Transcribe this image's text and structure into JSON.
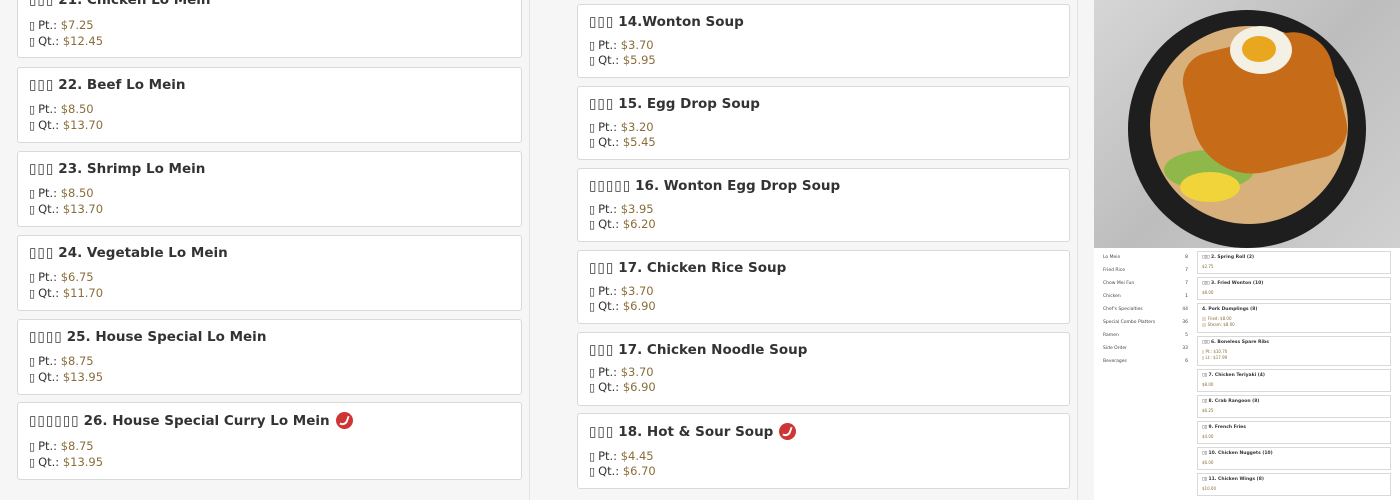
{
  "left_column": {
    "items": [
      {
        "cjk": "▯▯▯",
        "title": "21. Chicken Lo Mein",
        "pt_label": "Pt.:",
        "pt": "$7.25",
        "qt_label": "Qt.:",
        "qt": "$12.45"
      },
      {
        "cjk": "▯▯▯",
        "title": "22. Beef Lo Mein",
        "pt_label": "Pt.:",
        "pt": "$8.50",
        "qt_label": "Qt.:",
        "qt": "$13.70"
      },
      {
        "cjk": "▯▯▯",
        "title": "23. Shrimp Lo Mein",
        "pt_label": "Pt.:",
        "pt": "$8.50",
        "qt_label": "Qt.:",
        "qt": "$13.70"
      },
      {
        "cjk": "▯▯▯",
        "title": "24. Vegetable Lo Mein",
        "pt_label": "Pt.:",
        "pt": "$6.75",
        "qt_label": "Qt.:",
        "qt": "$11.70"
      },
      {
        "cjk": "▯▯▯▯",
        "title": "25. House Special Lo Mein",
        "pt_label": "Pt.:",
        "pt": "$8.75",
        "qt_label": "Qt.:",
        "qt": "$13.95"
      },
      {
        "cjk": "▯▯▯▯▯▯",
        "title": "26. House Special Curry Lo Mein",
        "pt_label": "Pt.:",
        "pt": "$8.75",
        "qt_label": "Qt.:",
        "qt": "$13.95",
        "spicy": true
      }
    ]
  },
  "middle_column": {
    "items": [
      {
        "cjk": "▯▯▯",
        "title": "14.Wonton Soup",
        "pt_label": "Pt.:",
        "pt": "$3.70",
        "qt_label": "Qt.:",
        "qt": "$5.95"
      },
      {
        "cjk": "▯▯▯",
        "title": "15. Egg Drop Soup",
        "pt_label": "Pt.:",
        "pt": "$3.20",
        "qt_label": "Qt.:",
        "qt": "$5.45"
      },
      {
        "cjk": "▯▯▯▯▯",
        "title": "16. Wonton Egg Drop Soup",
        "pt_label": "Pt.:",
        "pt": "$3.95",
        "qt_label": "Qt.:",
        "qt": "$6.20"
      },
      {
        "cjk": "▯▯▯",
        "title": "17. Chicken Rice Soup",
        "pt_label": "Pt.:",
        "pt": "$3.70",
        "qt_label": "Qt.:",
        "qt": "$6.90"
      },
      {
        "cjk": "▯▯▯",
        "title": "17. Chicken Noodle Soup",
        "pt_label": "Pt.:",
        "pt": "$3.70",
        "qt_label": "Qt.:",
        "qt": "$6.90"
      },
      {
        "cjk": "▯▯▯",
        "title": "18. Hot & Sour Soup",
        "pt_label": "Pt.:",
        "pt": "$4.45",
        "qt_label": "Qt.:",
        "qt": "$6.70",
        "spicy": true
      }
    ]
  },
  "box_glyph": "▯",
  "spicy_icon": "spicy-pepper-icon",
  "spicy_color": "#d03535",
  "price_color": "#8a6d3b",
  "thumbnail": {
    "categories": [
      {
        "name": "Lo Mein",
        "count": "8"
      },
      {
        "name": "Fried Rice",
        "count": "7"
      },
      {
        "name": "Chow Mei Fun",
        "count": "7"
      },
      {
        "name": "Chicken",
        "count": "1"
      },
      {
        "name": "Chef's Specialties",
        "count": "44"
      },
      {
        "name": "Special Combo Platters",
        "count": "36"
      },
      {
        "name": "Ramen",
        "count": "5"
      },
      {
        "name": "Side Order",
        "count": "33"
      },
      {
        "name": "Beverages",
        "count": "6"
      }
    ],
    "items": [
      {
        "name": "▯▯▯ 2. Spring Roll (2)",
        "prices": [
          "$2.75"
        ]
      },
      {
        "name": "▯▯▯ 3. Fried Wonton (10)",
        "prices": [
          "$8.00"
        ]
      },
      {
        "name": "4. Pork Dumplings (8)",
        "prices": [
          "▯▯ Fried: $8.00",
          "▯▯ Steam: $8.00"
        ]
      },
      {
        "name": "▯▯▯ 6. Boneless Spare Ribs",
        "prices": [
          "▯ Pt.: $10.70",
          "▯ Lt.: $17.99"
        ]
      },
      {
        "name": "▯▯ 7. Chicken Teriyaki (4)",
        "prices": [
          "$8.00"
        ]
      },
      {
        "name": "▯▯ 8. Crab Rangoon (8)",
        "prices": [
          "$6.25"
        ]
      },
      {
        "name": "▯▯ 9. French Fries",
        "prices": [
          "$4.00"
        ]
      },
      {
        "name": "▯▯ 10. Chicken Nuggets (10)",
        "prices": [
          "$6.00"
        ]
      },
      {
        "name": "▯▯ 11. Chicken Wings (8)",
        "prices": [
          "$10.00"
        ]
      }
    ]
  }
}
